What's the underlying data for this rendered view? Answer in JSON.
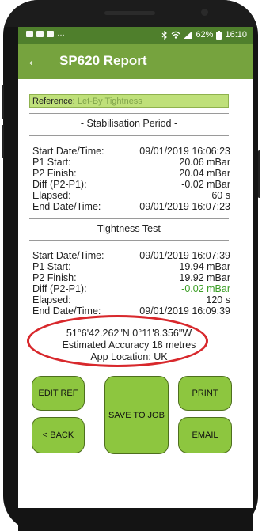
{
  "status_bar": {
    "left_dots": "…",
    "battery_percent": "62%",
    "time": "16:10"
  },
  "app_bar": {
    "back_glyph": "←",
    "title": "SP620 Report"
  },
  "reference": {
    "label": "Reference:",
    "value": "Let-By Tightness"
  },
  "stabilisation": {
    "title": "- Stabilisation Period -",
    "rows": [
      {
        "label": "Start Date/Time:",
        "value": "09/01/2019 16:06:23"
      },
      {
        "label": "P1 Start:",
        "value": "20.06 mBar"
      },
      {
        "label": "P2 Finish:",
        "value": "20.04 mBar"
      },
      {
        "label": "Diff (P2-P1):",
        "value": "-0.02 mBar"
      },
      {
        "label": "Elapsed:",
        "value": "60 s"
      },
      {
        "label": "End Date/Time:",
        "value": "09/01/2019 16:07:23"
      }
    ]
  },
  "tightness": {
    "title": "- Tightness Test -",
    "rows": [
      {
        "label": "Start Date/Time:",
        "value": "09/01/2019 16:07:39"
      },
      {
        "label": "P1 Start:",
        "value": "19.94 mBar"
      },
      {
        "label": "P2 Finish:",
        "value": "19.92 mBar"
      },
      {
        "label": "Diff (P2-P1):",
        "value": "-0.02 mBar"
      },
      {
        "label": "Elapsed:",
        "value": "120 s"
      },
      {
        "label": "End Date/Time:",
        "value": "09/01/2019 16:09:39"
      }
    ]
  },
  "gps": {
    "coordinates": "51°6'42.262\"N 0°11'8.356\"W",
    "accuracy": "Estimated Accuracy 18 metres",
    "location": "App Location: UK"
  },
  "buttons": {
    "edit_ref": "EDIT REF",
    "save_to_job": "SAVE TO JOB",
    "print": "PRINT",
    "back": "< BACK",
    "email": "EMAIL"
  },
  "colors": {
    "status_bar": "#4f7f2c",
    "app_bar": "#76a33e",
    "reference_bg": "#bfe07a",
    "button": "#8dc63f",
    "diff_green": "#3b9e25",
    "highlight_ellipse": "#d8282c"
  },
  "icons": [
    "gallery-icon",
    "message-icon",
    "notification-icon",
    "bluetooth-icon",
    "wifi-icon",
    "signal-icon",
    "battery-icon",
    "back-arrow-icon"
  ]
}
